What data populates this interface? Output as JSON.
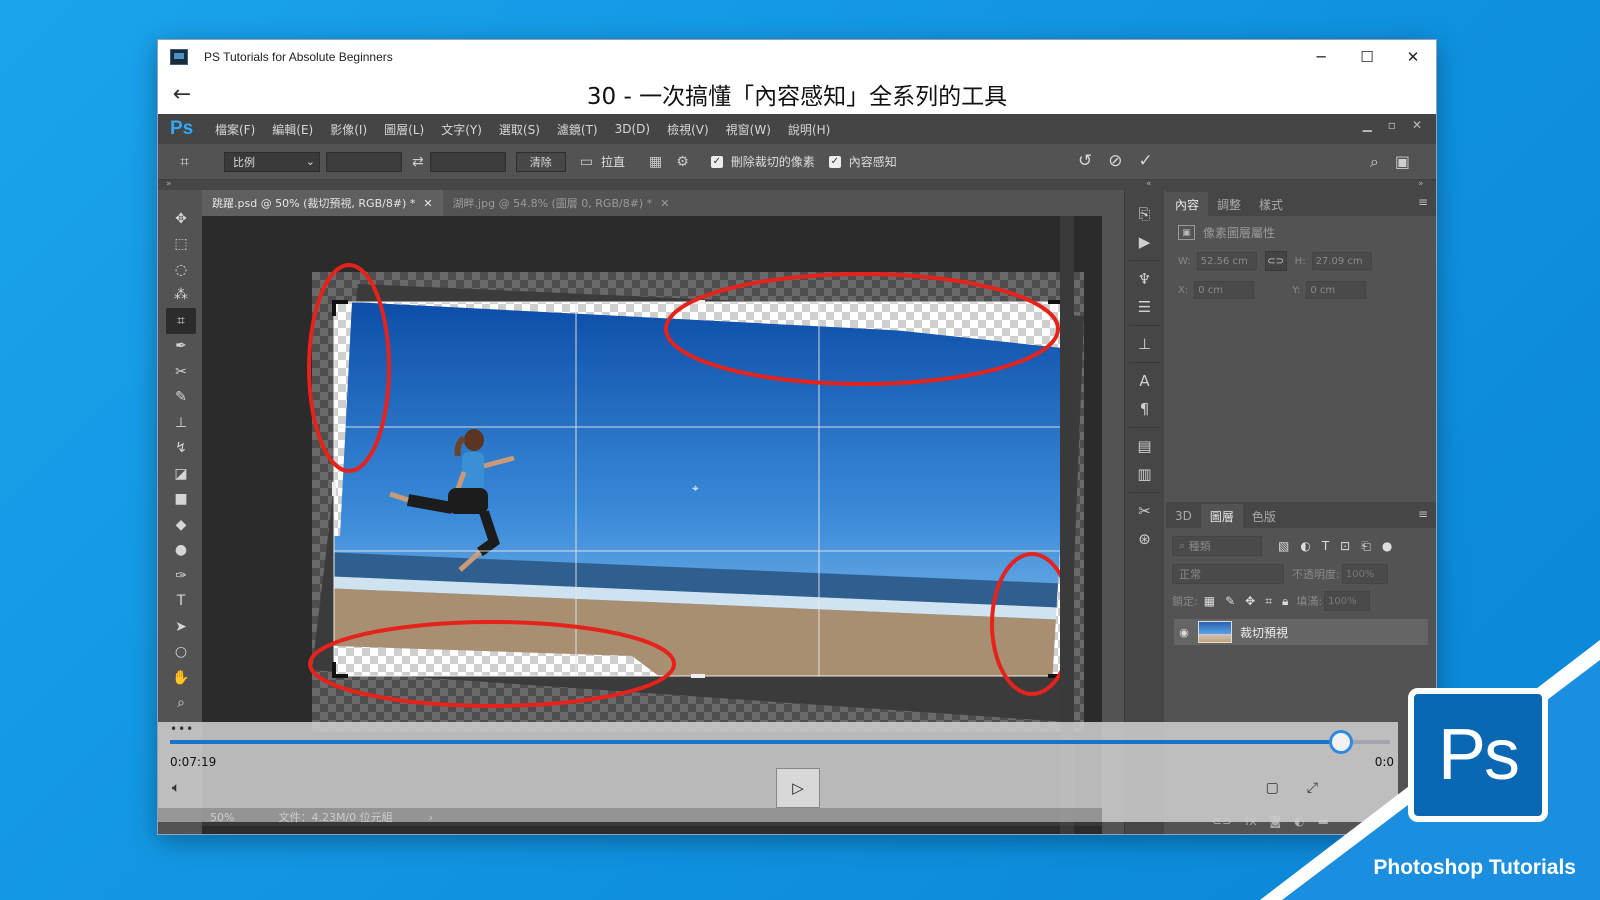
{
  "window": {
    "app_title": "PS Tutorials for Absolute Beginners",
    "lesson_title": "30 - 一次搞懂「內容感知」全系列的工具",
    "controls": {
      "minimize": "─",
      "maximize": "☐",
      "close": "✕"
    },
    "back": "←"
  },
  "photoshop": {
    "logo": "Ps",
    "menu": [
      "檔案(F)",
      "編輯(E)",
      "影像(I)",
      "圖層(L)",
      "文字(Y)",
      "選取(S)",
      "濾鏡(T)",
      "3D(D)",
      "檢視(V)",
      "視窗(W)",
      "說明(H)"
    ],
    "options": {
      "ratio_select": "比例",
      "clear_label": "清除",
      "straighten_label": "拉直",
      "delete_cropped_label": "刪除裁切的像素",
      "content_aware_label": "內容感知",
      "delete_cropped_checked": true,
      "content_aware_checked": true
    },
    "tabs": [
      {
        "label": "跳躍.psd @ 50% (裁切預視, RGB/8#) *",
        "active": true
      },
      {
        "label": "湖畔.jpg @ 54.8% (圖層 0, RGB/8#) *",
        "active": false
      }
    ],
    "properties_panel": {
      "tabs": [
        "內容",
        "調整",
        "樣式"
      ],
      "title": "像素圖層屬性",
      "w_label": "W:",
      "w_value": "52.56 cm",
      "h_label": "H:",
      "h_value": "27.09 cm",
      "x_label": "X:",
      "x_value": "0 cm",
      "y_label": "Y:",
      "y_value": "0 cm"
    },
    "layers_panel": {
      "tabs": [
        "3D",
        "圖層",
        "色版"
      ],
      "search_placeholder": "種類",
      "blend_mode": "正常",
      "opacity_label": "不透明度:",
      "opacity_value": "100%",
      "lock_label": "鎖定:",
      "fill_label": "填滿:",
      "fill_value": "100%",
      "layer_name": "裁切預視"
    },
    "status": {
      "zoom": "50%",
      "doc_info": "文件：4.23M/0 位元組"
    }
  },
  "player": {
    "current_time": "0:07:19",
    "total_time": "0:0",
    "progress": 0.96,
    "dots": "•••"
  },
  "badge": {
    "logo_text": "Ps",
    "caption": "Photoshop Tutorials"
  },
  "colors": {
    "desktop": "#1aa3ea",
    "ps_accent": "#31a8ff",
    "annotation_red": "#e5221b",
    "timeline_blue": "#1a73c7"
  }
}
